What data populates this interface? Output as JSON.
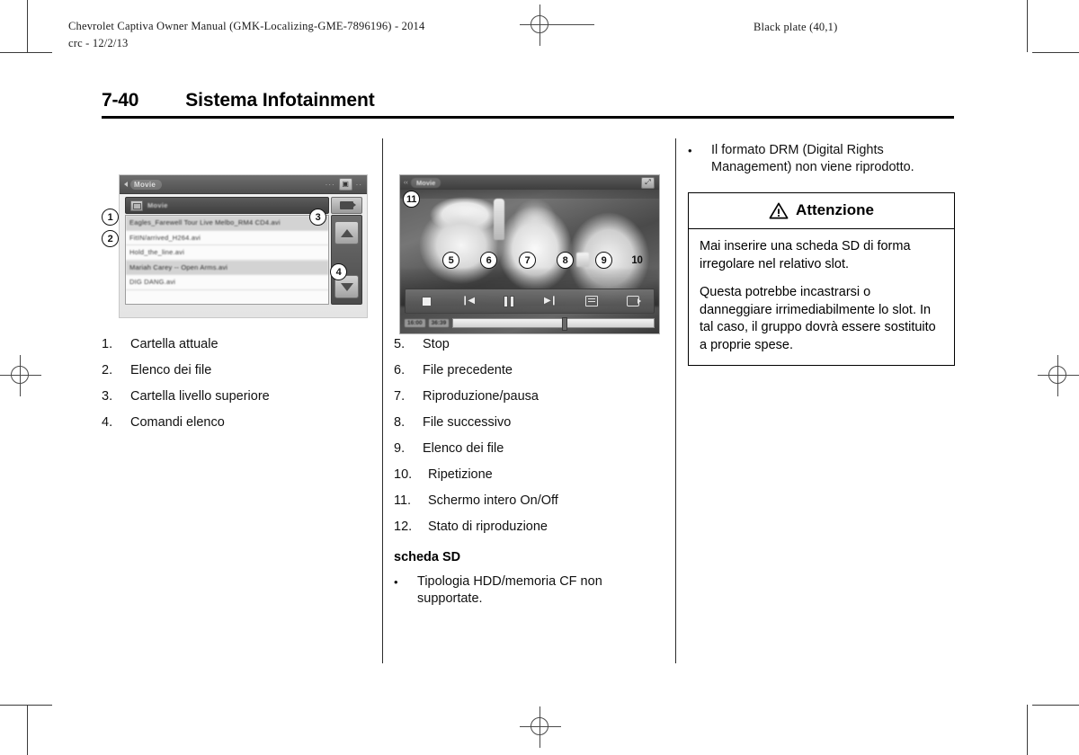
{
  "header": {
    "left_line1": "Chevrolet Captiva Owner Manual (GMK-Localizing-GME-7896196) - 2014",
    "left_line2": "crc - 12/2/13",
    "right": "Black plate (40,1)"
  },
  "title": {
    "page_number": "7-40",
    "text": "Sistema Infotainment"
  },
  "figure1": {
    "window_title": "Movie",
    "path_label": "Movie",
    "files": [
      "Eagles_Farewell Tour Live Melbo_RM4 CD4.avi",
      "FitIN/arrived_H264.avi",
      "Hold_the_line.avi",
      "Mariah Carey -- Open Arms.avi",
      "DIG DANG.avi"
    ],
    "callouts": [
      "1",
      "2",
      "3",
      "4"
    ]
  },
  "figure2": {
    "window_title": "Movie",
    "time_elapsed": "16:00",
    "time_total": "36:39",
    "callouts": [
      "11",
      "5",
      "6",
      "7",
      "8",
      "9",
      "10"
    ]
  },
  "list_left": [
    {
      "n": "1.",
      "text": "Cartella attuale"
    },
    {
      "n": "2.",
      "text": "Elenco dei file"
    },
    {
      "n": "3.",
      "text": "Cartella livello superiore"
    },
    {
      "n": "4.",
      "text": "Comandi elenco"
    }
  ],
  "list_middle": [
    {
      "n": "5.",
      "text": "Stop"
    },
    {
      "n": "6.",
      "text": "File precedente"
    },
    {
      "n": "7.",
      "text": "Riproduzione/pausa"
    },
    {
      "n": "8.",
      "text": "File successivo"
    },
    {
      "n": "9.",
      "text": "Elenco dei file"
    },
    {
      "n": "10.",
      "text": "Ripetizione"
    },
    {
      "n": "11.",
      "text": "Schermo intero On/Off"
    },
    {
      "n": "12.",
      "text": "Stato di riproduzione"
    }
  ],
  "middle_section": {
    "subhead": "scheda SD",
    "bullet_marker": "•",
    "bullet_text": "Tipologia HDD/memoria CF non supportate."
  },
  "right_column": {
    "bullet_marker": "•",
    "bullet_text": "Il formato DRM (Digital Rights Management) non viene riprodotto.",
    "caution": {
      "heading": "Attenzione",
      "warning_icon": "warning-triangle-icon",
      "paragraphs": [
        "Mai inserire una scheda SD di forma irregolare nel relativo slot.",
        "Questa potrebbe incastrarsi o danneggiare irrimediabilmente lo slot. In tal caso, il gruppo dovrà essere sostituito a proprie spese."
      ]
    }
  },
  "colors": {
    "ink": "#000000",
    "paper": "#ffffff",
    "rule": "#2b2b2b"
  }
}
